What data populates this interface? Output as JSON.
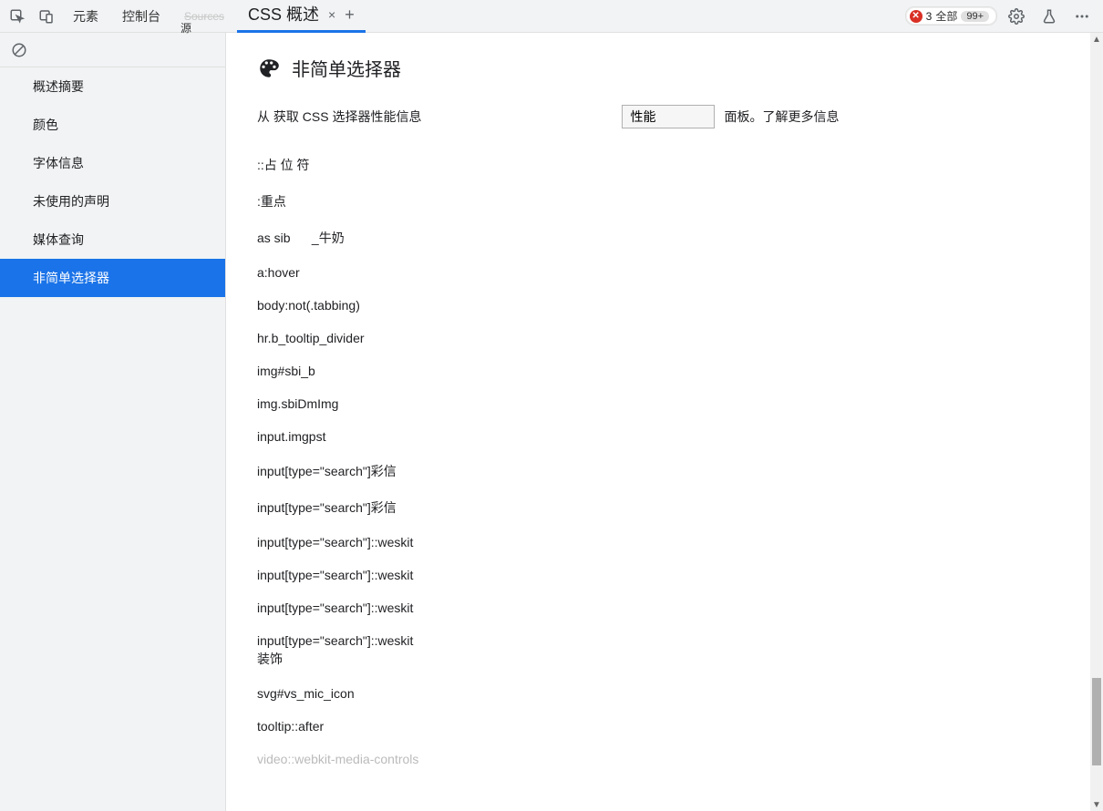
{
  "topbar": {
    "tabs": {
      "elements": "元素",
      "console": "控制台",
      "sources": "Sources",
      "css_overview": "CSS 概述",
      "close_x": "×",
      "plus": "+"
    },
    "errors": {
      "count": "3",
      "all_label": "全部",
      "badge": "99+"
    }
  },
  "sidebar": {
    "items": [
      {
        "label": "概述摘要"
      },
      {
        "label": "颜色"
      },
      {
        "label": "字体信息"
      },
      {
        "label": "未使用的声明"
      },
      {
        "label": "媒体查询"
      },
      {
        "label": "非简单选择器"
      }
    ]
  },
  "main": {
    "title": "非简单选择器",
    "info_prefix": "从 获取 CSS 选择器性能信息",
    "performance_btn": "性能",
    "info_suffix": "面板。了解更多信息",
    "selectors": [
      "::占 位 符",
      ":重点",
      "as sib      _牛奶",
      "a:hover",
      "body:not(.tabbing)",
      "hr.b_tooltip_divider",
      "img#sbi_b",
      "img.sbiDmImg",
      "input.imgpst",
      "input[type=\"search\"]彩信",
      "input[type=\"search\"]彩信",
      "input[type=\"search\"]::weskit",
      "input[type=\"search\"]::weskit",
      "input[type=\"search\"]::weskit",
      "input[type=\"search\"]::weskit",
      "装饰",
      "svg#vs_mic_icon",
      "tooltip::after",
      "video::webkit-media-controls"
    ]
  }
}
